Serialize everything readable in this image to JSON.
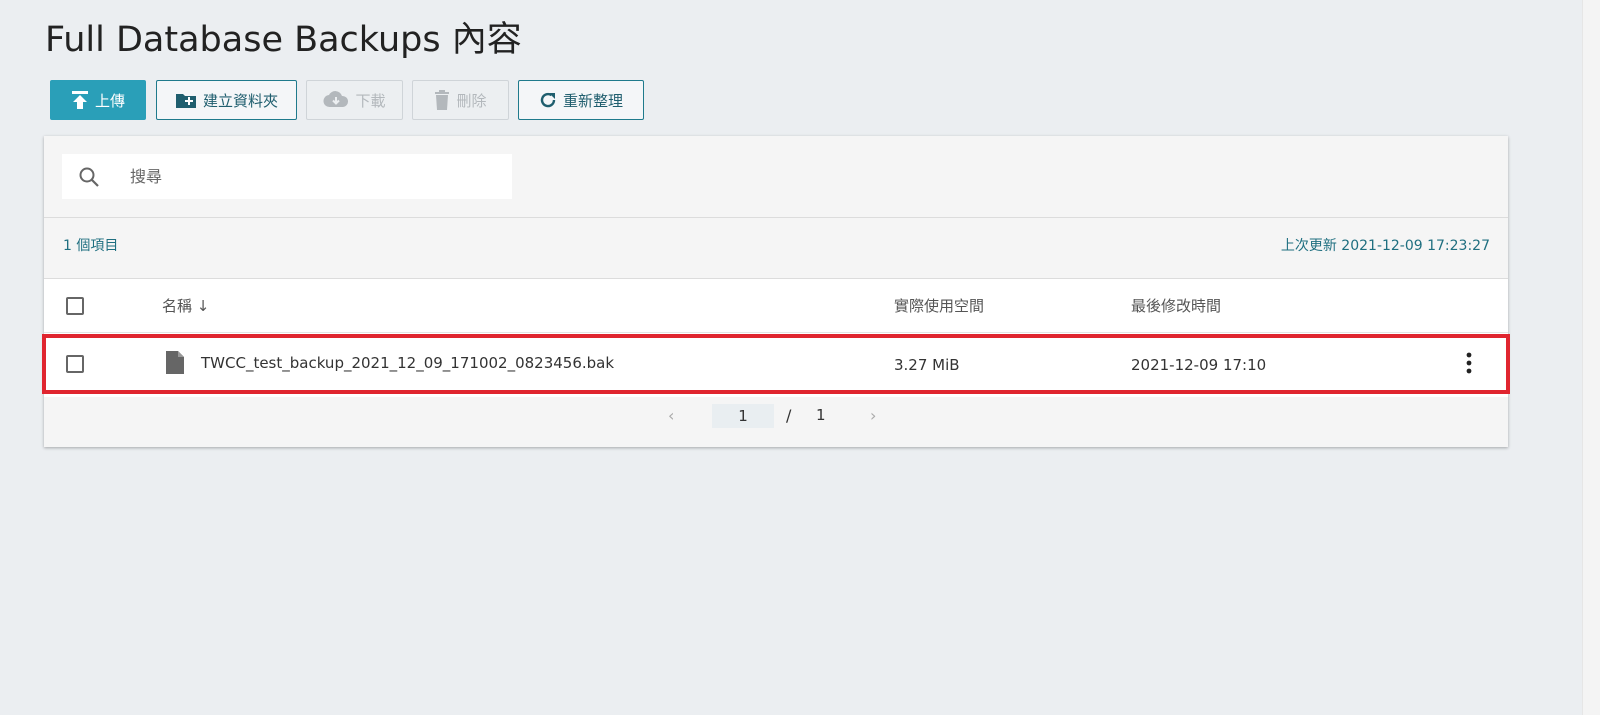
{
  "page": {
    "title": "Full Database Backups 內容"
  },
  "toolbar": {
    "upload_label": "上傳",
    "new_folder_label": "建立資料夾",
    "download_label": "下載",
    "delete_label": "刪除",
    "refresh_label": "重新整理"
  },
  "search": {
    "placeholder": "搜尋"
  },
  "summary": {
    "item_count": "1 個項目",
    "last_updated": "上次更新 2021-12-09 17:23:27"
  },
  "table": {
    "columns": {
      "name": "名稱",
      "sort_indicator": "↓",
      "size": "實際使用空間",
      "modified": "最後修改時間"
    },
    "rows": [
      {
        "name": "TWCC_test_backup_2021_12_09_171002_0823456.bak",
        "size": "3.27 MiB",
        "modified": "2021-12-09 17:10"
      }
    ]
  },
  "pagination": {
    "prev": "‹",
    "current": "1",
    "separator": "/",
    "total": "1",
    "next": "›"
  },
  "colors": {
    "primary": "#2a9fb8",
    "accent_text": "#1f6f80",
    "highlight": "#e0252f"
  }
}
